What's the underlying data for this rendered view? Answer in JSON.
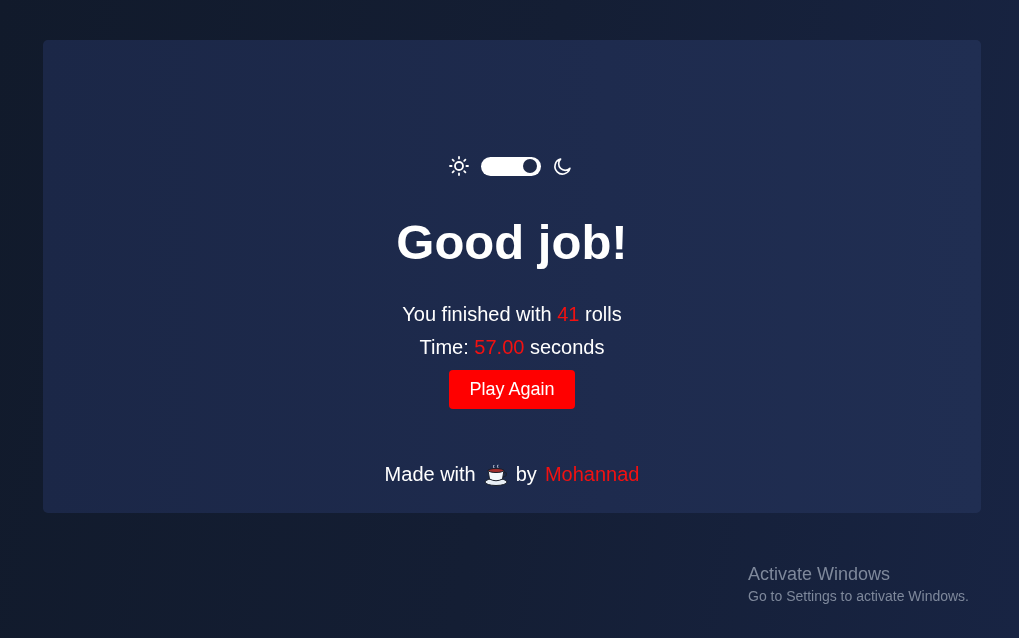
{
  "theme_switch": {
    "on": true
  },
  "result": {
    "title": "Good job!",
    "rolls": {
      "prefix": "You finished with",
      "value": "41",
      "suffix": "rolls"
    },
    "time": {
      "prefix": "Time:",
      "value": "57.00",
      "suffix": "seconds"
    },
    "button": "Play Again"
  },
  "footer": {
    "before": "Made with",
    "after": "by",
    "author": "Mohannad"
  },
  "system_notice": {
    "title": "Activate Windows",
    "subtitle": "Go to Settings to activate Windows."
  }
}
